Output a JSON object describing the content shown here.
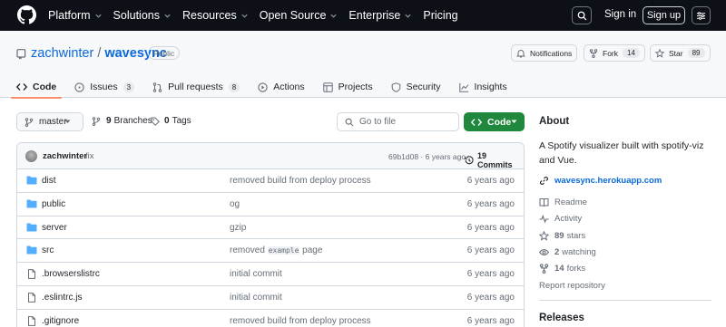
{
  "header": {
    "nav": [
      {
        "label": "Platform",
        "dropdown": true
      },
      {
        "label": "Solutions",
        "dropdown": true
      },
      {
        "label": "Resources",
        "dropdown": true
      },
      {
        "label": "Open Source",
        "dropdown": true
      },
      {
        "label": "Enterprise",
        "dropdown": true
      },
      {
        "label": "Pricing",
        "dropdown": false
      }
    ],
    "sign_in": "Sign in",
    "sign_up": "Sign up"
  },
  "repo": {
    "owner": "zachwinter",
    "separator": "/",
    "name": "wavesync",
    "visibility": "Public",
    "notifications_label": "Notifications",
    "fork_label": "Fork",
    "fork_count": "14",
    "star_label": "Star",
    "star_count": "89"
  },
  "tabs": [
    {
      "label": "Code",
      "icon": "code-icon",
      "count": "",
      "selected": true
    },
    {
      "label": "Issues",
      "icon": "issue-icon",
      "count": "3",
      "selected": false
    },
    {
      "label": "Pull requests",
      "icon": "pull-request-icon",
      "count": "8",
      "selected": false
    },
    {
      "label": "Actions",
      "icon": "play-icon",
      "count": "",
      "selected": false
    },
    {
      "label": "Projects",
      "icon": "table-icon",
      "count": "",
      "selected": false
    },
    {
      "label": "Security",
      "icon": "shield-icon",
      "count": "",
      "selected": false
    },
    {
      "label": "Insights",
      "icon": "graph-icon",
      "count": "",
      "selected": false
    }
  ],
  "branch_bar": {
    "branch": "master",
    "branches_count": "9",
    "branches_label": "Branches",
    "tags_count": "0",
    "tags_label": "Tags",
    "goto_placeholder": "Go to file",
    "code_button": "Code"
  },
  "latest_commit": {
    "author": "zachwinter",
    "message": "fix",
    "meta": "69b1d08 · 6 years ago",
    "commits": "19 Commits"
  },
  "files": [
    {
      "type": "dir",
      "name": "dist",
      "message": "removed build from deploy process",
      "message_code": "",
      "message_after": "",
      "time": "6 years ago"
    },
    {
      "type": "dir",
      "name": "public",
      "message": "og",
      "message_code": "",
      "message_after": "",
      "time": "6 years ago"
    },
    {
      "type": "dir",
      "name": "server",
      "message": "gzip",
      "message_code": "",
      "message_after": "",
      "time": "6 years ago"
    },
    {
      "type": "dir",
      "name": "src",
      "message": "removed ",
      "message_code": "example",
      "message_after": " page",
      "time": "6 years ago"
    },
    {
      "type": "file",
      "name": ".browserslistrc",
      "message": "initial commit",
      "message_code": "",
      "message_after": "",
      "time": "6 years ago"
    },
    {
      "type": "file",
      "name": ".eslintrc.js",
      "message": "initial commit",
      "message_code": "",
      "message_after": "",
      "time": "6 years ago"
    },
    {
      "type": "file",
      "name": ".gitignore",
      "message": "removed build from deploy process",
      "message_code": "",
      "message_after": "",
      "time": "6 years ago"
    }
  ],
  "about": {
    "title": "About",
    "description": "A Spotify visualizer built with spotify-viz and Vue.",
    "website": "wavesync.herokuapp.com",
    "readme": "Readme",
    "activity": "Activity",
    "stars_count": "89",
    "stars_label": "stars",
    "watching_count": "2",
    "watching_label": "watching",
    "forks_count": "14",
    "forks_label": "forks",
    "report": "Report repository"
  },
  "releases": {
    "title": "Releases"
  },
  "colors": {
    "header_bg": "#0d1117",
    "link": "#0969da",
    "code_button": "#1f883d",
    "folder": "#54aeff",
    "tab_underline": "#fd8c73"
  }
}
